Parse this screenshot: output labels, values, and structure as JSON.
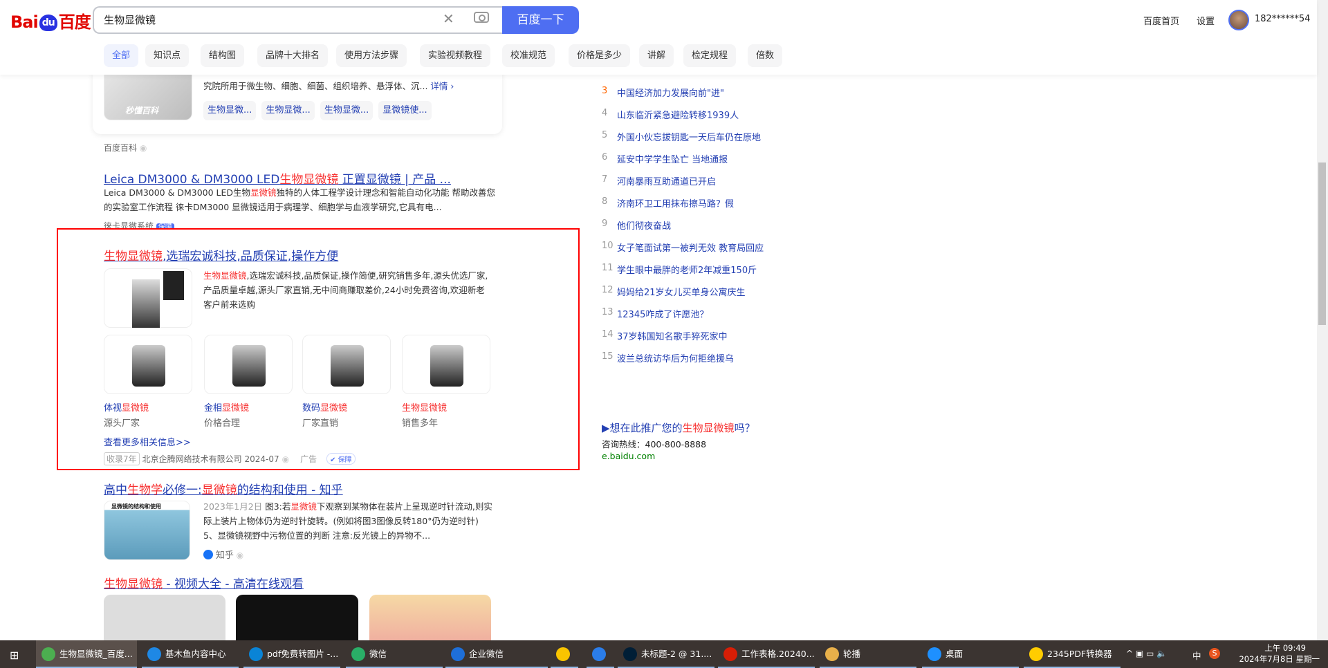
{
  "header": {
    "logo": "Bai du 百度",
    "search_value": "生物显微镜",
    "search_button": "百度一下",
    "home_link": "百度首页",
    "settings_link": "设置",
    "username": "182******54"
  },
  "tabs": [
    "全部",
    "知识点",
    "结构图",
    "品牌十大排名",
    "使用方法步骤",
    "实验视频教程",
    "校准规范",
    "价格是多少",
    "讲解",
    "检定规程",
    "倍数"
  ],
  "baike_card": {
    "desc": "究院所用于微生物、细胞、细菌、组织培养、悬浮体、沉...",
    "more": "详情 ›",
    "pills": [
      "生物显微...",
      "生物显微...",
      "生物显微...",
      "显微镜使..."
    ],
    "source": "百度百科",
    "img_text": "秒懂百科"
  },
  "results": [
    {
      "title_pre": "Leica DM3000 & DM3000 LED",
      "title_hl": "生物显微镜",
      "title_post": " 正置显微镜 | 产品 ...",
      "desc_pre": "Leica DM3000 & DM3000 LED生物",
      "desc_hl": "显微镜",
      "desc_post": "独特的人体工程学设计理念和智能自动化功能 帮助改善您的实验室工作流程 徕卡DM3000 显微镜适用于病理学、细胞学与血液学研究,它具有电...",
      "source": "徕卡显微系统",
      "badge": "保障"
    },
    {
      "title_pre": "高中",
      "title_hl": "生物学",
      "title_mid": "必修一:",
      "title_hl2": "显微镜",
      "title_post": "的结构和使用 - 知乎",
      "date": "2023年1月2日",
      "desc_pre": " 图3:若",
      "desc_hl": "显微镜",
      "desc_post": "下观察到某物体在装片上呈现逆时针流动,则实际上装片上物体仍为逆时针旋转。(例如将图3图像反转180°仍为逆时针) 5、显微镜视野中污物位置的判断 注意:反光镜上的异物不...",
      "source": "知乎",
      "img_text": "显微镜的结构和使用"
    },
    {
      "title_hl": "生物显微镜",
      "title_post": " - 视频大全 - 高清在线观看"
    }
  ],
  "ad": {
    "title_hl": "生物显微镜",
    "title_post": ",选瑞宏诚科技,品质保证,操作方便",
    "desc_hl": "生物显微镜",
    "desc_post": ",选瑞宏诚科技,品质保证,操作简便,研究销售多年,源头优选厂家,产品质量卓越,源头厂家直销,无中间商赚取差价,24小时免费咨询,欢迎新老客户前来选购",
    "products": [
      {
        "pre": "体视",
        "hl": "显微镜",
        "sub": "源头厂家"
      },
      {
        "pre": "金相",
        "hl": "显微镜",
        "sub": "价格合理"
      },
      {
        "pre": "数码",
        "hl": "显微镜",
        "sub": "厂家直销"
      },
      {
        "pre": "",
        "hl": "生物显微镜",
        "sub": "销售多年"
      }
    ],
    "more": "查看更多相关信息>>",
    "years": "收录7年",
    "company": "北京企腾网络技术有限公司 2024-07",
    "ad_label": "广告",
    "badge": "保障"
  },
  "hot": [
    {
      "n": "3",
      "t": "中国经济加力发展向前\"进\""
    },
    {
      "n": "4",
      "t": "山东临沂紧急避险转移1939人"
    },
    {
      "n": "5",
      "t": "外国小伙忘拔钥匙一天后车仍在原地"
    },
    {
      "n": "6",
      "t": "延安中学学生坠亡 当地通报"
    },
    {
      "n": "7",
      "t": "河南暴雨互助通道已开启"
    },
    {
      "n": "8",
      "t": "济南环卫工用抹布擦马路？假"
    },
    {
      "n": "9",
      "t": "他们彻夜奋战"
    },
    {
      "n": "10",
      "t": "女子笔面试第一被判无效 教育局回应"
    },
    {
      "n": "11",
      "t": "学生眼中最胖的老师2年减重150斤"
    },
    {
      "n": "12",
      "t": "妈妈给21岁女儿买单身公寓庆生"
    },
    {
      "n": "13",
      "t": "12345咋成了许愿池？"
    },
    {
      "n": "14",
      "t": "37岁韩国知名歌手猝死家中"
    },
    {
      "n": "15",
      "t": "波兰总统访华后为何拒绝援乌"
    }
  ],
  "promo": {
    "pre": "▶想在此推广您的",
    "hl": "生物显微镜",
    "post": "吗？",
    "hotline": "咨询热线：400-800-8888",
    "site": "e.baidu.com"
  },
  "taskbar": {
    "items": [
      "生物显微镜_百度...",
      "基木鱼内容中心",
      "pdf免费转图片 -...",
      "微信",
      "企业微信",
      "",
      "",
      "未标题-2 @ 31....",
      "工作表格.20240...",
      "轮播",
      "桌面",
      "2345PDF转换器"
    ],
    "tray_ime": "中",
    "time": "上午 09:49",
    "date": "2024年7月8日 星期一"
  },
  "colors": {
    "accent": "#4e6ef2",
    "link": "#2440b3",
    "highlight": "#f73131",
    "ad_border": "#ff0000"
  }
}
